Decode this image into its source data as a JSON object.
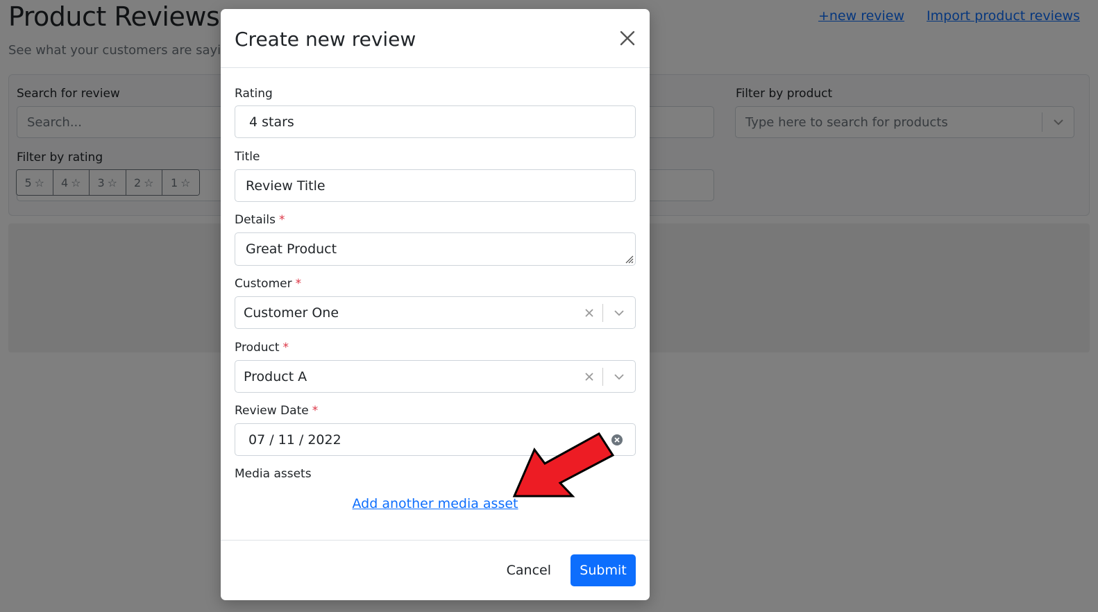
{
  "page": {
    "title": "Product Reviews",
    "subtitle": "See what your customers are saying",
    "links": {
      "new_review": "+new review",
      "import": "Import product reviews"
    }
  },
  "filters": {
    "search": {
      "label": "Search for review",
      "placeholder": "Search..."
    },
    "product": {
      "label": "Filter by product",
      "placeholder": "Type here to search for products"
    },
    "rating": {
      "label": "Filter by rating",
      "options": [
        "5",
        "4",
        "3",
        "2",
        "1"
      ]
    }
  },
  "modal": {
    "title": "Create new review",
    "fields": {
      "rating": {
        "label": "Rating",
        "value": "4 stars"
      },
      "title": {
        "label": "Title",
        "value": "Review Title"
      },
      "details": {
        "label": "Details",
        "value": "Great Product",
        "required": "*"
      },
      "customer": {
        "label": "Customer",
        "value": "Customer One",
        "required": "*"
      },
      "product": {
        "label": "Product",
        "value": "Product A",
        "required": "*"
      },
      "review_date": {
        "label": "Review Date",
        "value": "07 / 11 / 2022",
        "required": "*"
      },
      "media": {
        "label": "Media assets",
        "add_link": "Add another media asset"
      }
    },
    "footer": {
      "cancel": "Cancel",
      "submit": "Submit"
    }
  },
  "colors": {
    "primary": "#0d6efd",
    "required": "#dc3545",
    "annotation_arrow": "#ed1c24"
  }
}
